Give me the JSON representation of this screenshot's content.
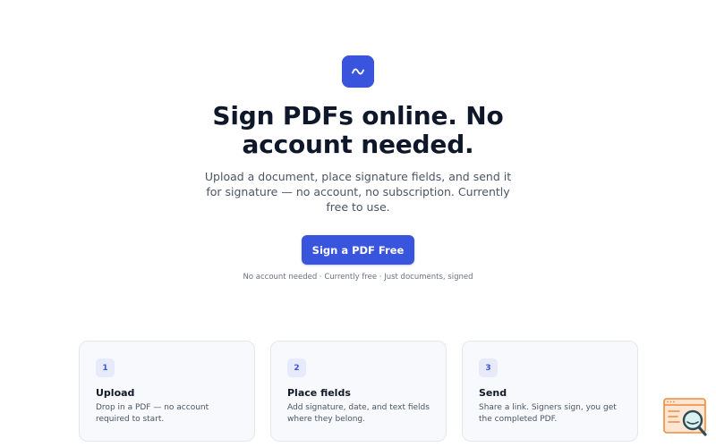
{
  "hero": {
    "logo_icon": "signature-wave-icon",
    "headline": "Sign PDFs online. No account needed.",
    "subheadline": "Upload a document, place signature fields, and send it for signature — no account, no subscription. Currently free to use.",
    "cta_label": "Sign a PDF Free",
    "note": "No account needed · Currently free · Just documents, signed"
  },
  "steps": [
    {
      "number": "1",
      "title": "Upload",
      "description": "Drop in a PDF — no account required to start."
    },
    {
      "number": "2",
      "title": "Place fields",
      "description": "Add signature, date, and text fields where they belong."
    },
    {
      "number": "3",
      "title": "Send",
      "description": "Share a link. Signers sign, you get the completed PDF."
    }
  ],
  "helper_widget": {
    "icon": "search-magnifier-icon"
  },
  "colors": {
    "accent": "#3a55dd",
    "heading": "#0f172a",
    "muted": "#6b7280",
    "card_bg": "#f8f9fc"
  }
}
